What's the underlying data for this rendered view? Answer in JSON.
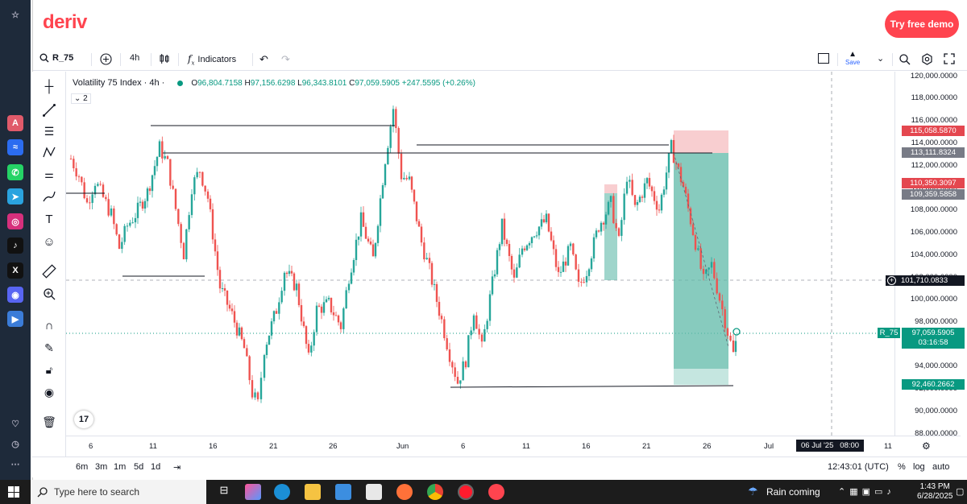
{
  "browser_sidebar": {
    "icons": [
      "home-icon",
      "ai-icon",
      "messenger-icon",
      "whatsapp-icon",
      "telegram-icon",
      "instagram-icon",
      "tiktok-icon",
      "x-icon",
      "discord-icon",
      "player-icon",
      "heart-icon",
      "history-icon",
      "more-icon"
    ],
    "colors": {
      "bg": "#1e2a3a"
    }
  },
  "header": {
    "logo": "deriv",
    "cta_label": "Try free demo",
    "brand_color": "#ff444f"
  },
  "toolbar": {
    "symbol": "R_75",
    "interval": "4h",
    "indicators_label": "Indicators",
    "save_label": "Save"
  },
  "chart": {
    "legend_title": "Volatility 75 Index · 4h ·",
    "open_label": "O",
    "open": "96,804.7158",
    "high_label": "H",
    "high": "97,156.6298",
    "low_label": "L",
    "low": "96,343.8101",
    "close_label": "C",
    "close": "97,059.5905",
    "change": "+247.5595 (+0.26%)",
    "indicator_count": "2",
    "up_color": "#26a69a",
    "down_color": "#ef5350"
  },
  "price_axis": {
    "ticks": [
      "120,000.0000",
      "118,000.0000",
      "116,000.0000",
      "114,000.0000",
      "112,000.0000",
      "110,000.0000",
      "108,000.0000",
      "106,000.0000",
      "104,000.0000",
      "102,000.0000",
      "100,000.0000",
      "98,000.0000",
      "94,000.0000",
      "92,000.0000",
      "90,000.0000",
      "88,000.0000"
    ],
    "tag_stop": "115,058.5870",
    "tag_entry": "113,111.8324",
    "tag_stop2": "110,350.3097",
    "tag_entry2": "109,359.5858",
    "tag_crosshair": "101,710.0833",
    "tag_symbol": "R_75",
    "tag_last": "97,059.5905",
    "tag_countdown": "03:16:58",
    "tag_target": "92,460.2662"
  },
  "time_axis": {
    "ticks": [
      "6",
      "11",
      "16",
      "21",
      "26",
      "Jun",
      "6",
      "11",
      "16",
      "21",
      "26",
      "Jul",
      "11"
    ],
    "crosshair_label": "06 Jul '25   08:00"
  },
  "bottom_bar": {
    "ranges": [
      "6m",
      "3m",
      "1m",
      "5d",
      "1d"
    ],
    "clock": "12:43:01 (UTC)",
    "percent_label": "%",
    "log_label": "log",
    "auto_label": "auto"
  },
  "taskbar": {
    "search_placeholder": "Type here to search",
    "weather": "Rain coming",
    "time": "1:43 PM",
    "date": "6/28/2025"
  }
}
